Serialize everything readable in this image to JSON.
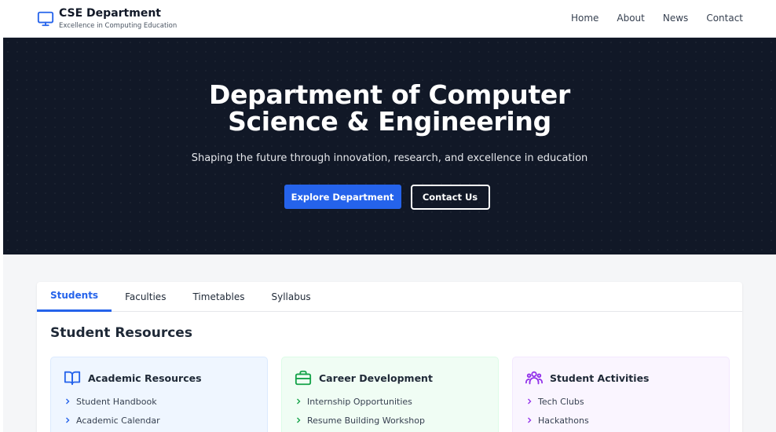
{
  "header": {
    "brand_title": "CSE Department",
    "brand_subtitle": "Excellence in Computing Education",
    "brand_icon": "monitor-icon",
    "nav": [
      "Home",
      "About",
      "News",
      "Contact"
    ]
  },
  "hero": {
    "title_line1": "Department of Computer",
    "title_line2": "Science & Engineering",
    "subtitle": "Shaping the future through innovation, research, and excellence in education",
    "primary_button": "Explore Department",
    "secondary_button": "Contact Us"
  },
  "tabs": {
    "items": [
      "Students",
      "Faculties",
      "Timetables",
      "Syllabus"
    ],
    "active": "Students"
  },
  "section": {
    "title": "Student Resources"
  },
  "cards": [
    {
      "title": "Academic Resources",
      "icon": "book-icon",
      "color": "#2563eb",
      "items": [
        "Student Handbook",
        "Academic Calendar"
      ]
    },
    {
      "title": "Career Development",
      "icon": "briefcase-icon",
      "color": "#16a34a",
      "items": [
        "Internship Opportunities",
        "Resume Building Workshop"
      ]
    },
    {
      "title": "Student Activities",
      "icon": "users-icon",
      "color": "#9333ea",
      "items": [
        "Tech Clubs",
        "Hackathons"
      ]
    }
  ],
  "colors": {
    "accent": "#2563eb",
    "hero_bg": "#111827"
  }
}
